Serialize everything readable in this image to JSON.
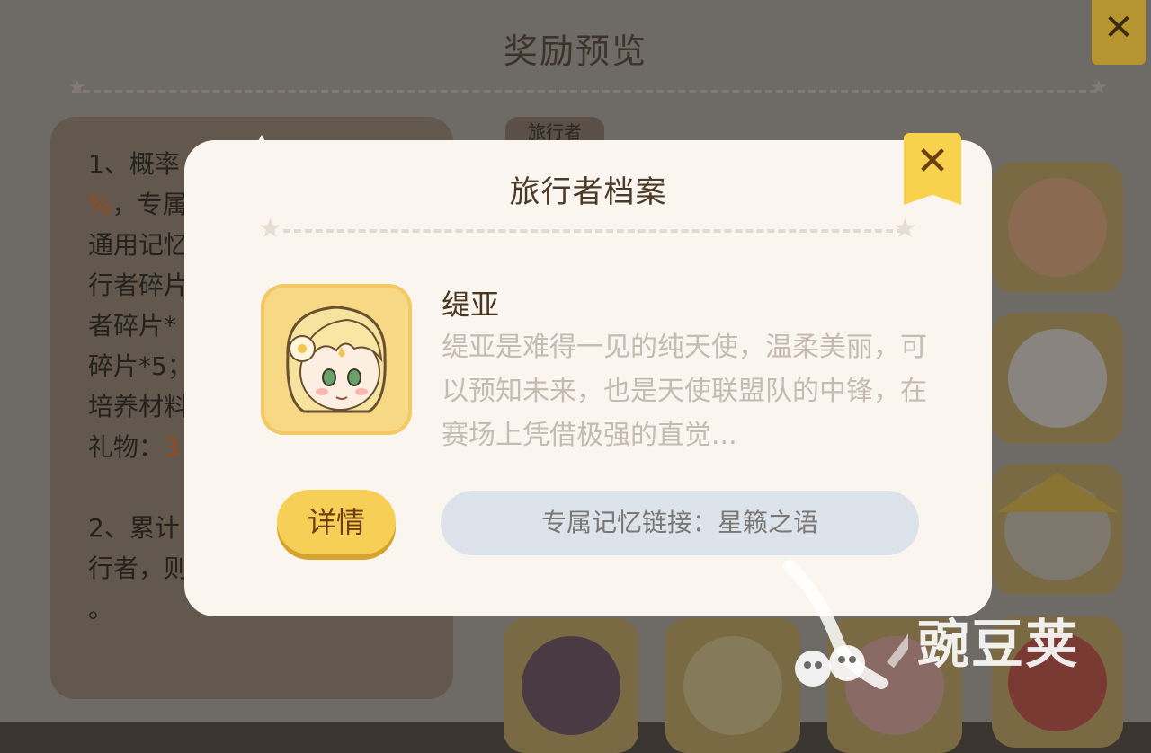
{
  "background": {
    "title": "奖励预览",
    "tab_label": "旅行者",
    "rules_lines": [
      {
        "text": "1、概率"
      },
      {
        "text": "%，专属",
        "highlight": "%"
      },
      {
        "text": "通用记忆"
      },
      {
        "text": "行者碎片"
      },
      {
        "text": "者碎片*"
      },
      {
        "text": "碎片*5；"
      },
      {
        "text": "培养材料"
      },
      {
        "text": "礼物：3",
        "highlight": "3"
      },
      {
        "text": ""
      },
      {
        "text": "2、累计"
      },
      {
        "text": "行者，则"
      },
      {
        "text": "。"
      }
    ]
  },
  "modal": {
    "title": "旅行者档案",
    "character_name": "缇亚",
    "character_description": "缇亚是难得一见的纯天使，温柔美丽，可以预知未来，也是天使联盟队的中锋，在赛场上凭借极强的直觉...",
    "detail_button_label": "详情",
    "memory_link_label": "专属记忆链接：星籁之语"
  },
  "watermark": {
    "text": "豌豆荚"
  },
  "colors": {
    "accent_yellow": "#f7cf57",
    "modal_bg": "#fbf5ef",
    "pill_bg": "#dde3ea"
  }
}
